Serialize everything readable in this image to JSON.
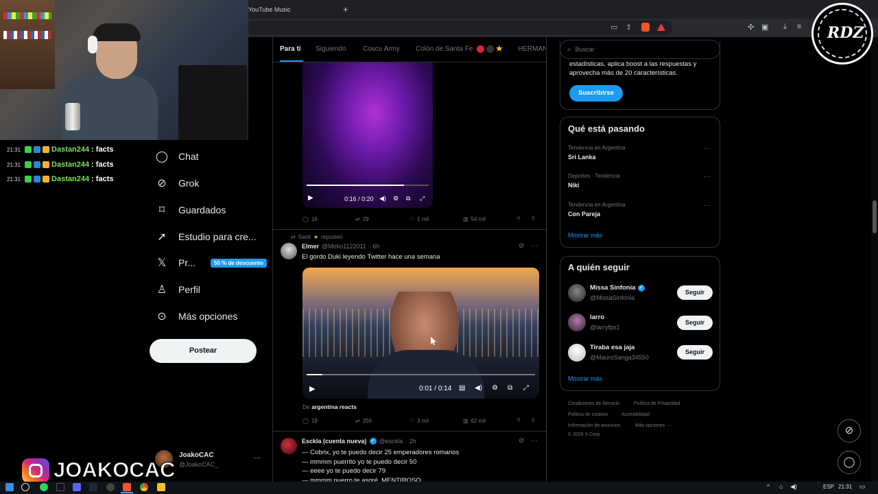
{
  "browser": {
    "tab_label": "YouTube Music",
    "new_tab_icon": "plus-icon"
  },
  "chat_overlay": {
    "messages": [
      {
        "time": "21:31",
        "user": "Dastan244",
        "text": ": facts"
      },
      {
        "time": "21:31",
        "user": "Dastan244",
        "text": ": facts"
      },
      {
        "time": "21:31",
        "user": "Dastan244",
        "text": ": facts"
      }
    ]
  },
  "streamer": {
    "brand": "JOAKOCAC",
    "logo_text": "RDZ"
  },
  "nav": {
    "items": [
      {
        "label": "Chat",
        "icon": "chat-icon"
      },
      {
        "label": "Grok",
        "icon": "grok-icon"
      },
      {
        "label": "Guardados",
        "icon": "bookmark-icon"
      },
      {
        "label": "Estudio para cre...",
        "icon": "rocket-icon"
      },
      {
        "label": "Pr...",
        "icon": "x-logo-icon"
      },
      {
        "label": "Perfil",
        "icon": "person-icon"
      },
      {
        "label": "Más opciones",
        "icon": "more-icon"
      }
    ],
    "promo_badge": "50 % de descuento",
    "post_button": "Postear",
    "account": {
      "name": "JoakoCAC",
      "handle": "@JoakoCAC_",
      "more": "···"
    }
  },
  "feed": {
    "tabs": [
      "Para ti",
      "Siguiendo",
      "Coscu Army",
      "Colón de Santa Fe",
      "HERMAN"
    ],
    "tweet1": {
      "video_time": "0:16 / 0:20",
      "video_progress": 0.8,
      "replies": "16",
      "reposts": "29",
      "likes": "1 mil",
      "views": "54 mil"
    },
    "tweet2": {
      "repost_label": "Santi",
      "repost_suffix": "reposteó",
      "name": "Elmer",
      "handle": "@Mirko1122011",
      "time": "· 6h",
      "text": "El gordo Duki leyendo Twitter hace una semana",
      "video_time": "0:01 / 0:14",
      "video_progress": 0.07,
      "source_prefix": "De",
      "source": "argentina reacts",
      "replies": "19",
      "reposts": "256",
      "likes": "3 mil",
      "views": "62 mil"
    },
    "tweet3": {
      "name": "Esckla (cuenta nueva)",
      "handle": "@esckla",
      "time": "· 2h",
      "lines": [
        "— Cobrix, yo te puedo decir 25 emperadores romanos",
        "— mmmm puerrito yo te puedo decir 50",
        "— eeee yo te puedo decir 79",
        "— mmmm puerro te asqré. MENTIROSO"
      ]
    }
  },
  "sidebar": {
    "search_placeholder": "Buscar",
    "premium_text_1": "estadísticas, aplica boost a las respuestas y",
    "premium_text_2": "aprovecha más de 20 características.",
    "subscribe": "Suscribirse",
    "trends_title": "Qué está pasando",
    "trends": [
      {
        "meta": "Tendencia en Argentina",
        "name": "Sri Lanka"
      },
      {
        "meta": "Deportes · Tendencia",
        "name": "Niki"
      },
      {
        "meta": "Tendencia en Argentina",
        "name": "Con Pareja"
      }
    ],
    "show_more": "Mostrar más",
    "follow_title": "A quién seguir",
    "follow": [
      {
        "name": "Missa Sinfonia",
        "handle": "@MissaSinfonia",
        "verified": true
      },
      {
        "name": "larro",
        "handle": "@larryfps1",
        "verified": false
      },
      {
        "name": "Tiraba esa jaja",
        "handle": "@MauroSanga34550",
        "verified": false
      }
    ],
    "follow_button": "Seguir",
    "footer": [
      "Condiciones de Servicio",
      "Política de Privacidad",
      "Política de cookies",
      "Accesibilidad",
      "Información de anuncios",
      "Más opciones ···",
      "© 2026 X Corp."
    ]
  },
  "taskbar": {
    "lang": "ESP",
    "time": "21:31"
  },
  "colors": {
    "accent": "#1d9bf0",
    "background": "#000000",
    "border": "#2f3336",
    "chat_user": "#7ce05a"
  }
}
